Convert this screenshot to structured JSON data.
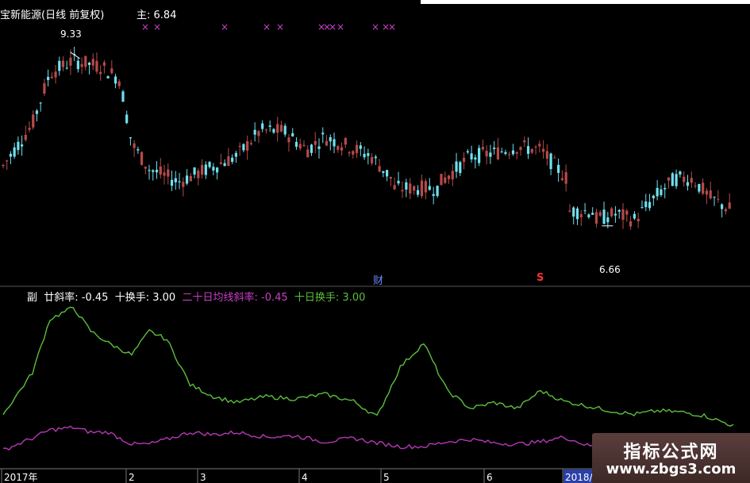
{
  "header": {
    "main_title": "宝新能源(日线 前复权)",
    "main_label": "主",
    "main_value": ": 6.84",
    "sub_label": "副",
    "ind1_label": "廿斜率",
    "ind1_value": ": -0.45",
    "ind2_label": "十换手",
    "ind2_value": ": 3.00",
    "ind3_label": "二十日均线斜率",
    "ind3_value": ": -0.45",
    "ind4_label": "十日换手",
    "ind4_value": ": 3.00"
  },
  "annotations": {
    "high_marker": "9.33",
    "low_marker": "6.66",
    "cai_marker": "财",
    "s_marker": "S",
    "x_marker": "×"
  },
  "x_axis_labels": [
    {
      "label": "2017年"
    },
    {
      "label": "2"
    },
    {
      "label": "3"
    },
    {
      "label": "4"
    },
    {
      "label": "5"
    },
    {
      "label": "6"
    },
    {
      "label": "2018/0",
      "highlight": true
    }
  ],
  "colors": {
    "up": "#b84a4a",
    "down": "#6fe0ee",
    "green_line": "#5bbf3e",
    "purple_line": "#b638b6",
    "x_marker": "#d040d0",
    "text": "#ffffff",
    "divider": "#555555"
  },
  "chart_data": [
    {
      "type": "candlestick",
      "title": "宝新能源(日线 前复权)",
      "y_range": [
        5.8,
        9.8
      ],
      "last_close": 6.84,
      "high_annotation": 9.33,
      "low_annotation": 6.66,
      "x_segments": [
        {
          "from": 0.0,
          "to": 25.0,
          "points": [
            [
              0,
              7.55
            ],
            [
              5,
              8.2
            ],
            [
              8,
              9.0
            ],
            [
              12,
              9.2
            ],
            [
              17,
              9.1
            ],
            [
              20,
              8.9
            ],
            [
              22,
              7.9
            ],
            [
              25,
              7.5
            ]
          ]
        },
        {
          "from": 25.0,
          "to": 67.0,
          "points": [
            [
              25,
              7.5
            ],
            [
              30,
              7.3
            ],
            [
              35,
              7.5
            ],
            [
              40,
              7.7
            ],
            [
              44,
              8.1
            ],
            [
              48,
              8.1
            ],
            [
              52,
              7.8
            ],
            [
              55,
              8.0
            ],
            [
              58,
              7.9
            ],
            [
              63,
              7.7
            ],
            [
              67,
              7.3
            ]
          ]
        },
        {
          "from": 67.0,
          "to": 75.0,
          "points": [
            [
              67,
              7.2
            ],
            [
              70,
              7.2
            ],
            [
              75,
              7.2
            ]
          ]
        },
        {
          "from": 75.0,
          "to": 97.0,
          "points": [
            [
              75,
              7.3
            ],
            [
              80,
              7.7
            ],
            [
              84,
              7.75
            ],
            [
              88,
              7.85
            ],
            [
              92,
              7.8
            ],
            [
              95,
              7.5
            ],
            [
              97,
              7.3
            ]
          ]
        },
        {
          "from": 97.0,
          "to": 125.0,
          "points": [
            [
              101,
              6.7
            ],
            [
              105,
              6.8
            ],
            [
              108,
              6.7
            ],
            [
              112,
              7.1
            ],
            [
              115,
              7.35
            ],
            [
              118,
              7.35
            ],
            [
              121,
              7.05
            ],
            [
              125,
              6.84
            ]
          ]
        }
      ]
    },
    {
      "type": "line",
      "title": "",
      "y_range": [
        -4,
        10
      ],
      "x": [
        0,
        5,
        8,
        12,
        15,
        18,
        22,
        25,
        28,
        32,
        36,
        40,
        45,
        50,
        55,
        60,
        64,
        68,
        72,
        76,
        80,
        84,
        88,
        92,
        96,
        100,
        104,
        108,
        112,
        116,
        120,
        125
      ],
      "series": [
        {
          "name": "二十日均线斜率",
          "color": "#5bbf3e",
          "values": [
            0.5,
            4.0,
            8.5,
            9.5,
            7.5,
            6.5,
            5.5,
            7.5,
            6.8,
            3.0,
            2.0,
            1.5,
            2.0,
            1.8,
            2.2,
            1.6,
            0.3,
            4.5,
            6.5,
            2.5,
            1.0,
            1.5,
            1.0,
            2.5,
            1.6,
            1.2,
            0.8,
            0.5,
            0.8,
            0.7,
            0.4,
            -0.45
          ]
        },
        {
          "name": "十日换手",
          "color": "#b638b6",
          "values": [
            -2.5,
            -1.5,
            -0.8,
            -0.6,
            -1.0,
            -1.0,
            -2.0,
            -2.0,
            -1.6,
            -1.0,
            -1.2,
            -1.0,
            -1.4,
            -1.3,
            -1.8,
            -1.5,
            -1.9,
            -2.2,
            -2.2,
            -1.8,
            -1.6,
            -1.9,
            -2.0,
            -1.8,
            -1.4,
            -2.1,
            -2.3,
            -2.0,
            -2.0,
            -1.9,
            -2.1,
            -2.1
          ]
        }
      ]
    }
  ]
}
